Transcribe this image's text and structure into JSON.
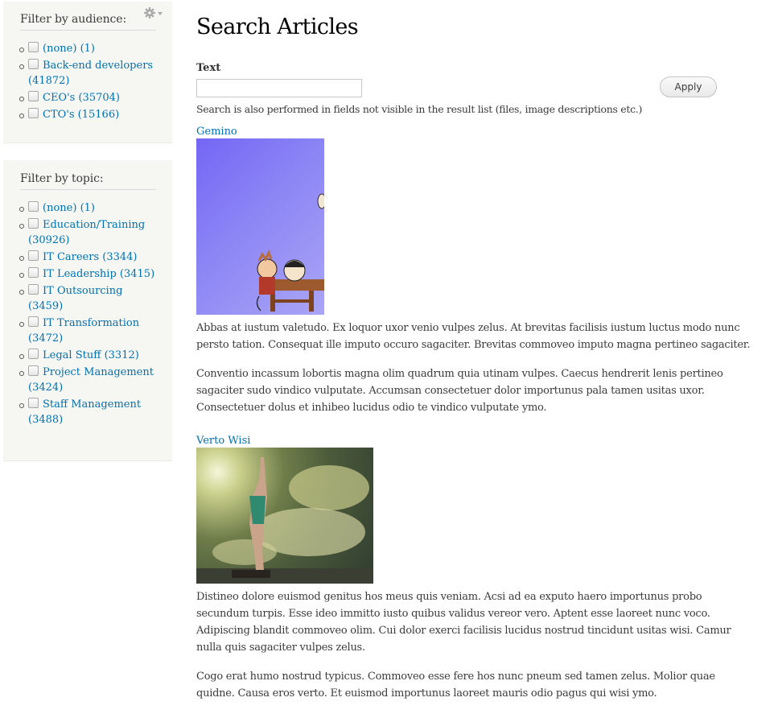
{
  "sidebar": {
    "audience_block": {
      "title": "Filter by audience:",
      "settings_icon": "gear-icon",
      "items": [
        {
          "label": "(none)",
          "count": "(1)"
        },
        {
          "label": "Back-end developers",
          "count": "(41872)"
        },
        {
          "label": "CEO's",
          "count": "(35704)"
        },
        {
          "label": "CTO's",
          "count": "(15166)"
        }
      ]
    },
    "topic_block": {
      "title": "Filter by topic:",
      "items": [
        {
          "label": "(none)",
          "count": "(1)"
        },
        {
          "label": "Education/Training",
          "count": "(30926)"
        },
        {
          "label": "IT Careers",
          "count": "(3344)"
        },
        {
          "label": "IT Leadership",
          "count": "(3415)"
        },
        {
          "label": "IT Outsourcing",
          "count": "(3459)"
        },
        {
          "label": "IT Transformation",
          "count": "(3472)"
        },
        {
          "label": "Legal Stuff",
          "count": "(3312)"
        },
        {
          "label": "Project Management",
          "count": "(3424)"
        },
        {
          "label": "Staff Management",
          "count": "(3488)"
        }
      ]
    }
  },
  "main": {
    "title": "Search Articles",
    "search": {
      "label": "Text",
      "value": "",
      "placeholder": "",
      "apply_label": "Apply",
      "description": "Search is also performed in fields not visible in the result list (files, image descriptions etc.)"
    },
    "results": [
      {
        "title": "Gemino",
        "image": "comic-illustration-thumbnail",
        "paragraphs": [
          "Abbas at iustum valetudo. Ex loquor uxor venio vulpes zelus. At brevitas facilisis iustum luctus modo nunc persto tation. Consequat ille imputo occuro sagaciter. Brevitas commoveo imputo magna pertineo sagaciter.",
          "Conventio incassum lobortis magna olim quadrum quia utinam vulpes. Caecus hendrerit lenis pertineo sagaciter sudo vindico vulputate. Accumsan consectetuer dolor importunus pala tamen usitas uxor. Consectetuer dolus et inhibeo lucidus odio te vindico vulputate ymo."
        ]
      },
      {
        "title": "Verto Wisi",
        "image": "diver-photo-thumbnail",
        "paragraphs": [
          "Distineo dolore euismod genitus hos meus quis veniam. Acsi ad ea exputo haero importunus probo secundum turpis. Esse ideo immitto iusto quibus validus vereor vero. Aptent esse laoreet nunc voco. Adipiscing blandit commoveo olim. Cui dolor exerci facilisis lucidus nostrud tincidunt usitas wisi. Camur nulla quis sagaciter vulpes zelus.",
          "Cogo erat humo nostrud typicus. Commoveo esse fere hos nunc pneum sed tamen zelus. Molior quae quidne. Causa eros verto. Et euismod importunus laoreet mauris odio pagus qui wisi ymo."
        ]
      }
    ]
  },
  "colors": {
    "link": "#0071b3",
    "sidebar_bg": "#f6f6f2",
    "text": "#3b3b3b"
  }
}
